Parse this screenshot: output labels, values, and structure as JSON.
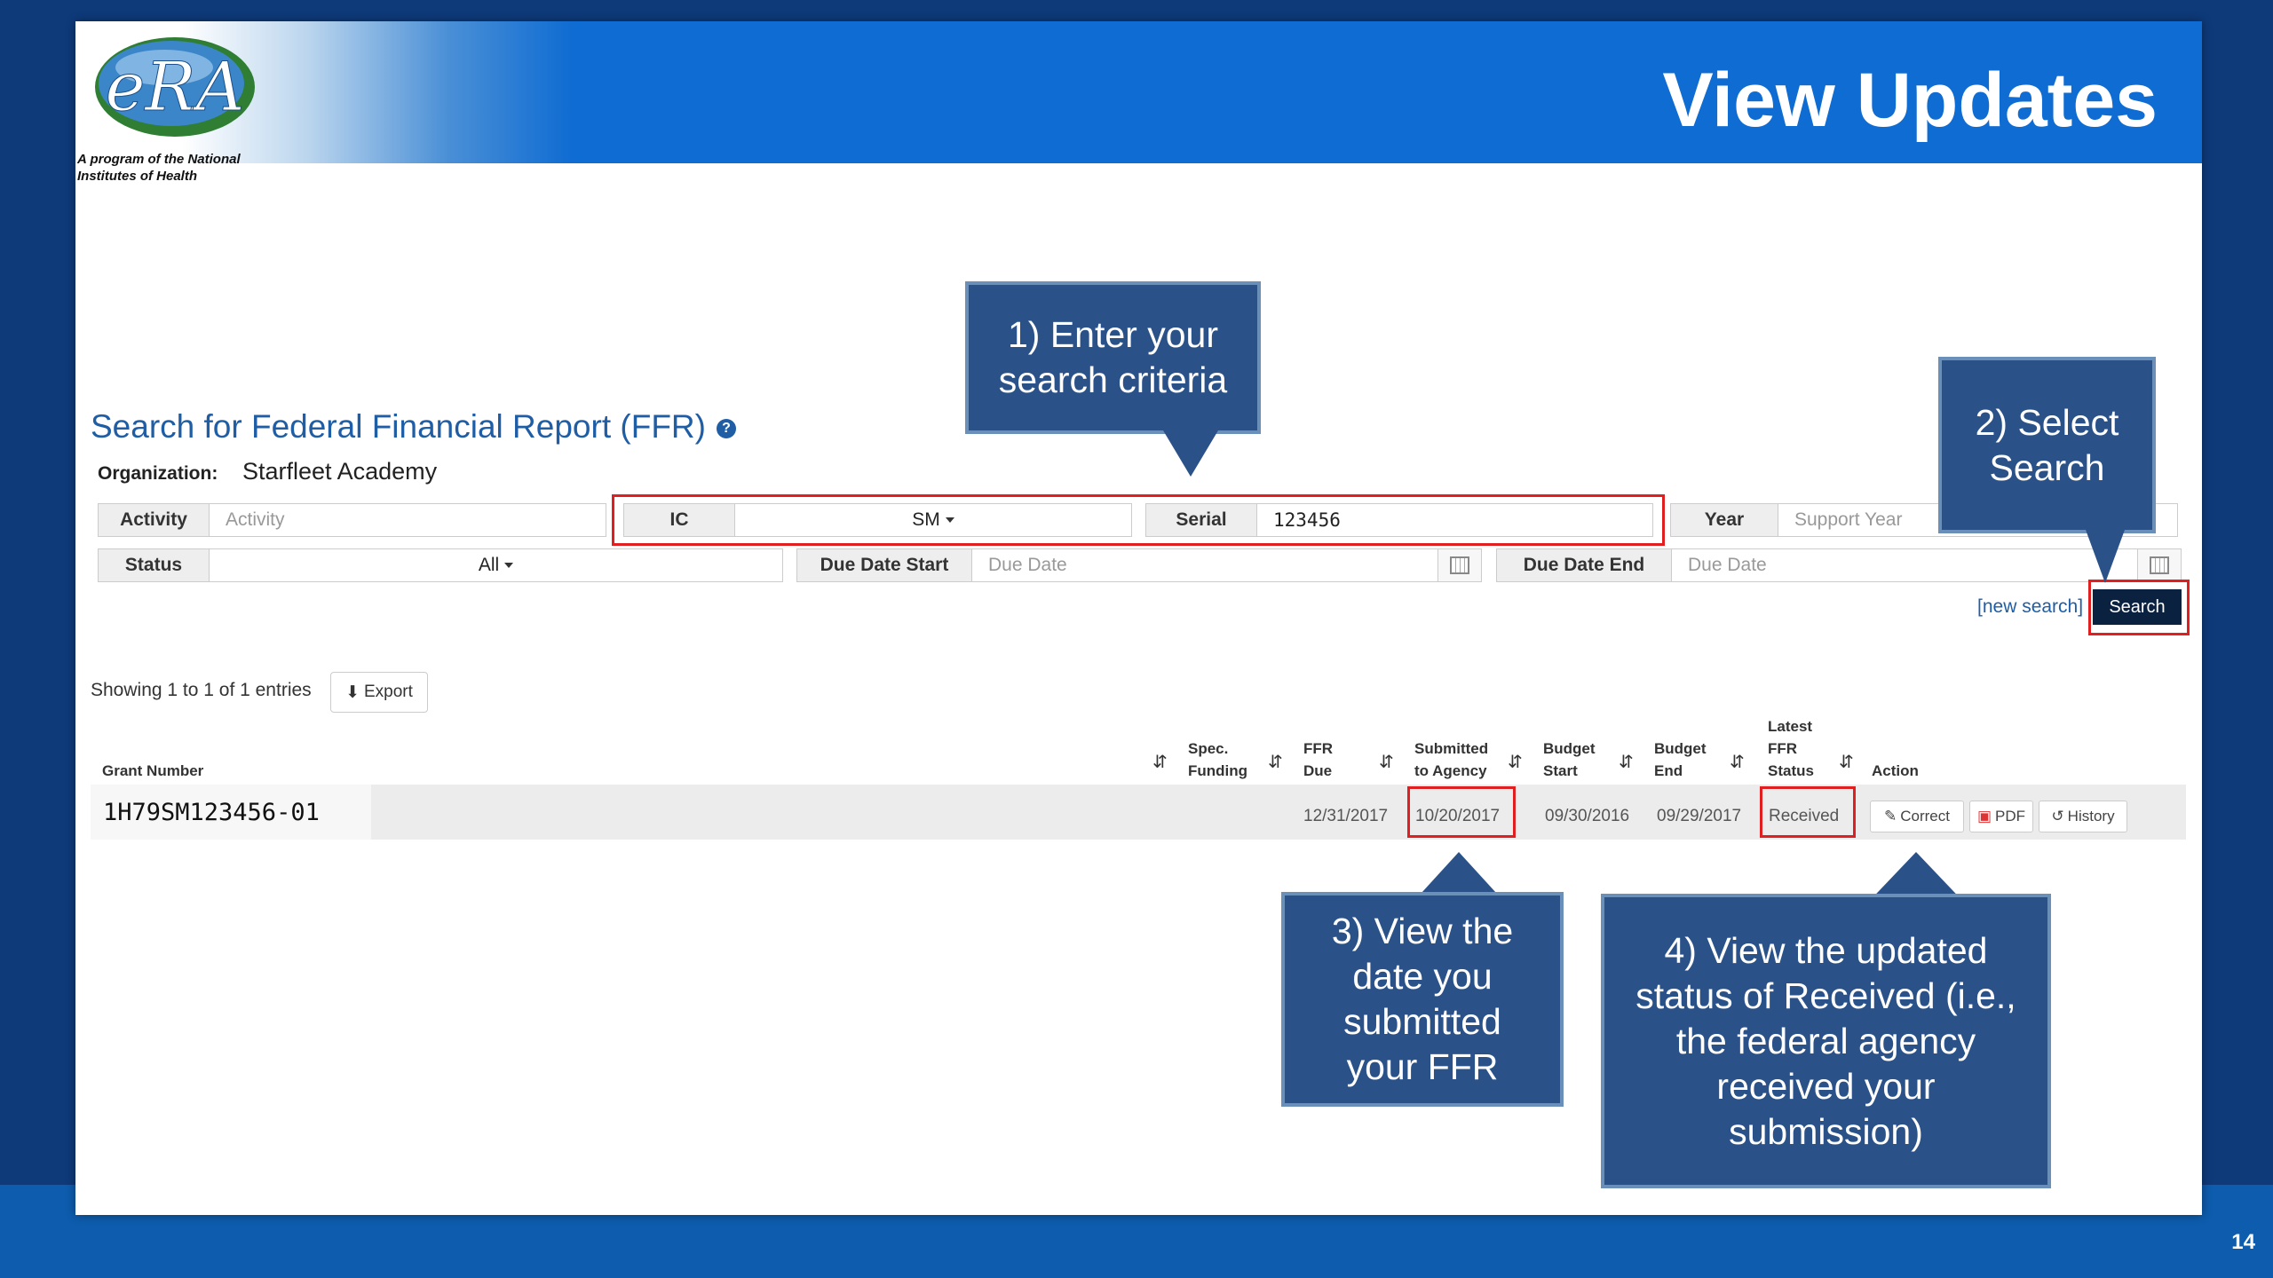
{
  "slide": {
    "title": "View Updates",
    "logo_text": "eRA",
    "logo_caption": "A program of the National Institutes of Health",
    "page_number": "14"
  },
  "form": {
    "heading": "Search for Federal Financial Report (FFR)",
    "help_icon": "question-circle-icon",
    "organization_label": "Organization:",
    "organization_value": "Starfleet Academy",
    "activity": {
      "label": "Activity",
      "placeholder": "Activity"
    },
    "ic": {
      "label": "IC",
      "value": "SM"
    },
    "serial": {
      "label": "Serial",
      "value": "123456"
    },
    "year": {
      "label": "Year",
      "placeholder": "Support Year"
    },
    "status": {
      "label": "Status",
      "value": "All"
    },
    "due_date_start": {
      "label": "Due Date Start",
      "placeholder": "Due Date"
    },
    "due_date_end": {
      "label": "Due Date End",
      "placeholder": "Due Date"
    },
    "new_search_link": "[new search]",
    "search_button": "Search"
  },
  "results": {
    "showing": "Showing 1 to 1 of 1 entries",
    "export_button": "Export",
    "columns": {
      "grant_number": "Grant Number",
      "spec_funding_1": "Spec.",
      "spec_funding_2": "Funding",
      "ffr_due_1": "FFR",
      "ffr_due_2": "Due",
      "submitted_1": "Submitted",
      "submitted_2": "to Agency",
      "budget_start_1": "Budget",
      "budget_start_2": "Start",
      "budget_end_1": "Budget",
      "budget_end_2": "End",
      "latest_1": "Latest",
      "latest_2": "FFR",
      "latest_3": "Status",
      "action": "Action"
    },
    "rows": [
      {
        "grant_number": "1H79SM123456-01",
        "spec_funding": "",
        "ffr_due": "12/31/2017",
        "submitted_to_agency": "10/20/2017",
        "budget_start": "09/30/2016",
        "budget_end": "09/29/2017",
        "latest_ffr_status": "Received",
        "actions": {
          "correct": "Correct",
          "pdf": "PDF",
          "history": "History"
        }
      }
    ]
  },
  "callouts": {
    "c1": [
      "1) Enter your",
      "search criteria"
    ],
    "c2": [
      "2) Select",
      "Search"
    ],
    "c3": [
      "3) View the",
      "date you",
      "submitted",
      "your FFR"
    ],
    "c4": [
      "4) View the updated",
      "status of Received (i.e.,",
      "the federal agency",
      "received your",
      "submission)"
    ]
  },
  "colors": {
    "background": "#0e3a7a",
    "banner": "#0f6cd2",
    "callout": "#2a5289",
    "highlight": "#e02020",
    "link": "#1f5da5",
    "search_button": "#0b2140"
  }
}
